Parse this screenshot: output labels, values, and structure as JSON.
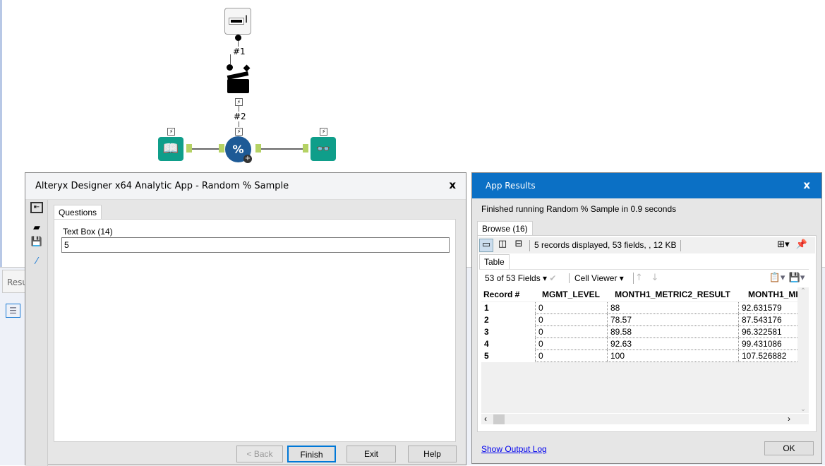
{
  "canvas": {
    "tools": [
      {
        "name": "text-box-tool",
        "label": "#1"
      },
      {
        "name": "action-tool",
        "label": "#2"
      },
      {
        "name": "input-tool"
      },
      {
        "name": "random-sample-tool",
        "glyph": "%"
      },
      {
        "name": "browse-tool"
      }
    ]
  },
  "background": {
    "results_tab": "Results"
  },
  "analytic_app": {
    "title": "Alteryx Designer x64 Analytic App - Random % Sample",
    "close": "x",
    "tab": "Questions",
    "field_label": "Text Box (14)",
    "field_value": "5",
    "buttons": {
      "back": "< Back",
      "finish": "Finish",
      "exit": "Exit",
      "help": "Help"
    }
  },
  "app_results": {
    "title": "App Results",
    "close": "x",
    "status": "Finished running Random % Sample in 0.9 seconds",
    "browse_tab": "Browse (16)",
    "summary": "5 records displayed, 53 fields, , 12 KB",
    "table_tab": "Table",
    "fields_dropdown": "53 of 53 Fields",
    "cell_viewer": "Cell Viewer",
    "columns": [
      "Record #",
      "MGMT_LEVEL",
      "MONTH1_METRIC2_RESULT",
      "MONTH1_MI"
    ],
    "rows": [
      [
        "1",
        "0",
        "88",
        "92.631579"
      ],
      [
        "2",
        "0",
        "78.57",
        "87.543176"
      ],
      [
        "3",
        "0",
        "89.58",
        "96.322581"
      ],
      [
        "4",
        "0",
        "92.63",
        "99.431086"
      ],
      [
        "5",
        "0",
        "100",
        "107.526882"
      ]
    ],
    "show_log": "Show Output Log",
    "ok": "OK",
    "accent": "#0b70c5"
  }
}
